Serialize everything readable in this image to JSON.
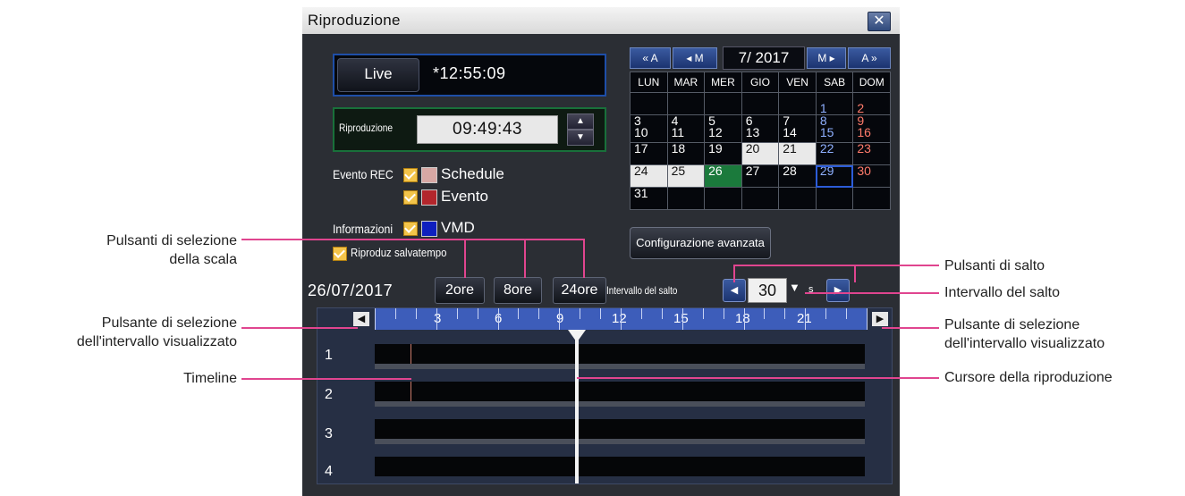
{
  "window": {
    "title": "Riproduzione",
    "close_icon": "close-icon"
  },
  "live": {
    "button_label": "Live",
    "time": "*12:55:09"
  },
  "playback": {
    "label": "Riproduzione",
    "time": "09:49:43"
  },
  "filters": {
    "event_rec_label": "Evento REC",
    "schedule_label": "Schedule",
    "event_label": "Evento",
    "info_label": "Informazioni",
    "vmd_label": "VMD",
    "saver_label": "Riproduz salvatempo",
    "colors": {
      "schedule": "#d7a8a4",
      "event": "#b3262c",
      "vmd": "#0f1fbf"
    }
  },
  "calendar": {
    "nav": {
      "prev_year": "« A",
      "prev_month": "◂ M",
      "next_month": "M ▸",
      "next_year": "A »"
    },
    "month_label": "7/ 2017",
    "weekdays": [
      "LUN",
      "MAR",
      "MER",
      "GIO",
      "VEN",
      "SAB",
      "DOM"
    ],
    "weeks": [
      [
        "",
        "",
        "",
        "",
        "",
        "1",
        "2"
      ],
      [
        "3\n10",
        "4\n11",
        "5\n12",
        "6\n13",
        "7\n14",
        "8\n15",
        "9\n16"
      ],
      [
        "17",
        "18",
        "19",
        "20",
        "21",
        "22",
        "23"
      ],
      [
        "24",
        "25",
        "26",
        "27",
        "28",
        "29",
        "30"
      ],
      [
        "31",
        "",
        "",
        "",
        "",
        "",
        ""
      ]
    ]
  },
  "advanced_button": "Configurazione avanzata",
  "timeline_header": {
    "date": "26/07/2017",
    "scale_2h": "2ore",
    "scale_8h": "8ore",
    "scale_24h": "24ore",
    "jump_label": "Intervallo del salto",
    "jump_value": "30",
    "jump_unit": "s"
  },
  "timeline": {
    "hours": [
      "3",
      "6",
      "9",
      "12",
      "15",
      "18",
      "21"
    ],
    "cameras": [
      "1",
      "2",
      "3",
      "4"
    ]
  },
  "callouts": {
    "scale_buttons": "Pulsanti di selezione\ndella scala",
    "range_left": "Pulsante di selezione\ndell'intervallo visualizzato",
    "timeline": "Timeline",
    "jump_buttons": "Pulsanti di salto",
    "jump_interval": "Intervallo del salto",
    "range_right": "Pulsante di selezione\ndell'intervallo visualizzato",
    "cursor": "Cursore della riproduzione"
  }
}
